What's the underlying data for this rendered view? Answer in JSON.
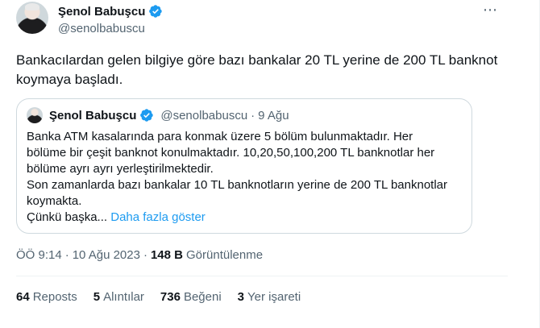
{
  "author": {
    "name": "Şenol Babuşcu",
    "handle": "@senolbabuscu"
  },
  "more_icon": "⋯",
  "tweet": {
    "text": "Bankacılardan gelen bilgiye göre bazı bankalar 20 TL yerine de 200 TL banknot koymaya başladı."
  },
  "quote": {
    "name": "Şenol Babuşcu",
    "handle": "@senolbabuscu",
    "dot": "·",
    "date": "9 Ağu",
    "body": "Banka ATM kasalarında para konmak üzere 5 bölüm bulunmaktadır. Her\nbölüme bir çeşit banknot konulmaktadır. 10,20,50,100,200 TL banknotlar her\nbölüme ayrı ayrı yerleştirilmektedir.\nSon zamanlarda bazı bankalar 10 TL banknotların yerine de 200 TL banknotlar\nkoymakta.\nÇünkü başka...",
    "show_more": "Daha fazla göster"
  },
  "meta": {
    "time": "ÖÖ 9:14",
    "sep1": "·",
    "date": "10 Ağu 2023",
    "sep2": "·",
    "views_count": "148 B",
    "views_label": "Görüntülenme"
  },
  "stats": [
    {
      "num": "64",
      "label": "Reposts"
    },
    {
      "num": "5",
      "label": "Alıntılar"
    },
    {
      "num": "736",
      "label": "Beğeni"
    },
    {
      "num": "3",
      "label": "Yer işareti"
    }
  ],
  "colors": {
    "accent": "#1d9bf0",
    "secondary_text": "#536471",
    "primary_text": "#0f1419"
  }
}
